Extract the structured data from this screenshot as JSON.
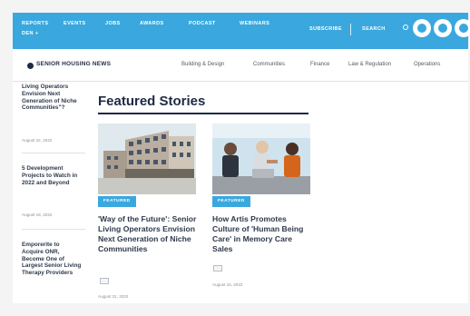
{
  "colors": {
    "accent": "#3aa8de",
    "dark_navy": "#1f2a44",
    "story_text": "#2f3a4c"
  },
  "topbar": {
    "nav_items": [
      "REPORTS",
      "EVENTS",
      "JOBS",
      "AWARDS",
      "PODCAST",
      "WEBINARS"
    ],
    "nav_overflow": "DEN +",
    "subscribe_label": "SUBSCRIBE",
    "search_label": "SEARCH",
    "social_icons": [
      "facebook-icon",
      "twitter-icon",
      "linkedin-icon"
    ]
  },
  "subnav": {
    "logo_text": "SENIOR HOUSING NEWS",
    "categories": [
      "Building & Design",
      "Communities",
      "Finance",
      "Law & Regulation",
      "Operations"
    ]
  },
  "sidebar": {
    "items": [
      {
        "title": "Living Operators Envision Next Generation of Niche Communities\"?",
        "date": "August 22, 2022"
      },
      {
        "title": "5 Development Projects to Watch in 2022 and Beyond",
        "date": "August 18, 2022"
      },
      {
        "title": "Emporerite to Acquire ONR, Become One of Largest Senior Living Therapy Providers",
        "date": "August 18, 2022"
      }
    ]
  },
  "main": {
    "heading": "Featured Stories",
    "stories": [
      {
        "badge": "FEATURED",
        "title": "'Way of the Future': Senior Living Operators Envision Next Generation of Niche Communities",
        "date": "August 22, 2022"
      },
      {
        "badge": "FEATURED",
        "title": "How Artis Promotes Culture of 'Human Being Care' in Memory Care Sales",
        "date": "August 15, 2022"
      }
    ]
  }
}
